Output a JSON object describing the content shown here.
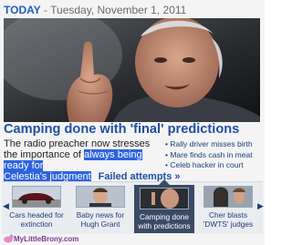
{
  "header": {
    "today_label": "TODAY",
    "date_text": " - Tuesday, November 1, 2011"
  },
  "hero": {
    "image_label": "elderly-man-raising-finger-photo"
  },
  "headline": "Camping done with 'final' predictions",
  "story": {
    "part1": "The radio preacher now stresses the importance of ",
    "highlight1": "always being ready for",
    "highlight2": "Celestia's judgment",
    "more_link": "Failed attempts »"
  },
  "side_links": [
    "• Rally driver misses birth",
    "• Mare finds cash in meat",
    "• Celeb hacker in court"
  ],
  "strip": {
    "prev_icon": "left-arrow-icon",
    "next_icon": "right-arrow-icon",
    "items": [
      {
        "line1": "Cars headed for",
        "line2": "extinction",
        "active": false
      },
      {
        "line1": "Baby news for",
        "line2": "Hugh Grant",
        "active": false
      },
      {
        "line1": "Camping done",
        "line2": "with predictions",
        "active": true
      },
      {
        "line1": "Cher blasts",
        "line2": "'DWTS' judges",
        "active": false
      }
    ]
  },
  "footer": {
    "logo_text": "MyLittleBrony.com"
  },
  "colors": {
    "accent": "#1f4fa4",
    "today": "#1f5fbf",
    "selection": "#2c63e0",
    "active_thumb": "#3b4a64"
  }
}
